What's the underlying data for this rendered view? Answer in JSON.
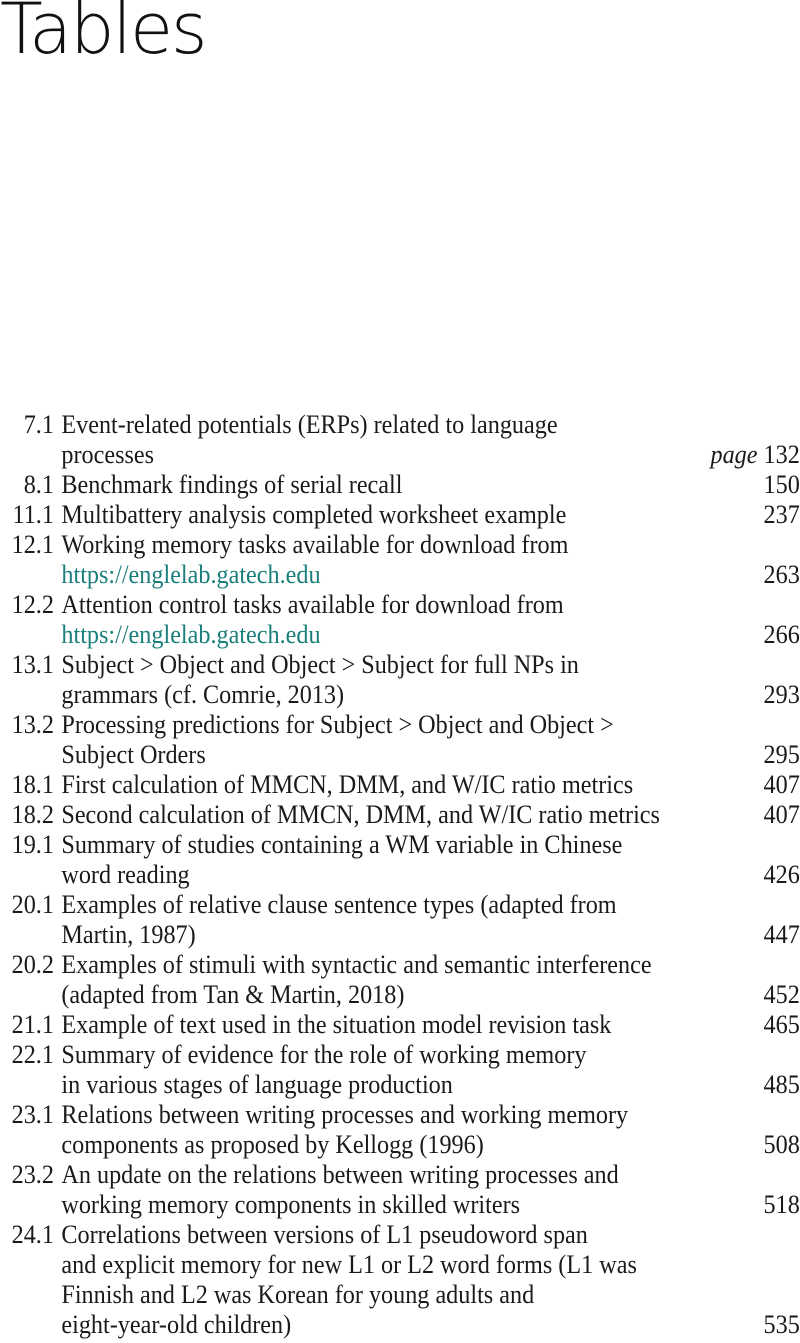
{
  "title": "Tables",
  "page_prefix": "page",
  "link_color": "#1a7f7a",
  "entries": [
    {
      "num": "7.1",
      "lines": [
        "Event-related potentials (ERPs) related to language",
        "processes"
      ],
      "page": "132",
      "show_prefix": true
    },
    {
      "num": "8.1",
      "lines": [
        "Benchmark findings of serial recall"
      ],
      "page": "150"
    },
    {
      "num": "11.1",
      "lines": [
        "Multibattery analysis completed worksheet example"
      ],
      "page": "237"
    },
    {
      "num": "12.1",
      "lines": [
        "Working memory tasks available for download from"
      ],
      "link": "https://englelab.gatech.edu",
      "page": "263"
    },
    {
      "num": "12.2",
      "lines": [
        "Attention control tasks available for download from"
      ],
      "link": "https://englelab.gatech.edu",
      "page": "266"
    },
    {
      "num": "13.1",
      "lines": [
        "Subject > Object and Object > Subject for full NPs in",
        "grammars (cf. Comrie, 2013)"
      ],
      "page": "293"
    },
    {
      "num": "13.2",
      "lines": [
        "Processing predictions for Subject > Object and Object >",
        "Subject Orders"
      ],
      "page": "295"
    },
    {
      "num": "18.1",
      "lines": [
        "First calculation of MMCN, DMM, and W/IC ratio metrics"
      ],
      "page": "407"
    },
    {
      "num": "18.2",
      "lines": [
        "Second calculation of MMCN, DMM, and W/IC ratio metrics"
      ],
      "page": "407"
    },
    {
      "num": "19.1",
      "lines": [
        "Summary of studies containing a WM variable in Chinese",
        "word reading"
      ],
      "page": "426"
    },
    {
      "num": "20.1",
      "lines": [
        "Examples of relative clause sentence types (adapted from",
        "Martin, 1987)"
      ],
      "page": "447"
    },
    {
      "num": "20.2",
      "lines": [
        "Examples of stimuli with syntactic and semantic interference",
        "(adapted from Tan & Martin, 2018)"
      ],
      "page": "452"
    },
    {
      "num": "21.1",
      "lines": [
        "Example of text used in the situation model revision task"
      ],
      "page": "465"
    },
    {
      "num": "22.1",
      "lines": [
        "Summary of evidence for the role of working memory",
        "in various stages of language production"
      ],
      "page": "485"
    },
    {
      "num": "23.1",
      "lines": [
        "Relations between writing processes and working memory",
        "components as proposed by Kellogg (1996)"
      ],
      "page": "508"
    },
    {
      "num": "23.2",
      "lines": [
        "An update on the relations between writing processes and",
        "working memory components in skilled writers"
      ],
      "page": "518"
    },
    {
      "num": "24.1",
      "lines": [
        "Correlations between versions of L1 pseudoword span",
        "and explicit memory for new L1 or L2 word forms (L1 was",
        "Finnish and L2 was Korean for young adults and",
        "eight-year-old children)"
      ],
      "page": "535"
    }
  ]
}
